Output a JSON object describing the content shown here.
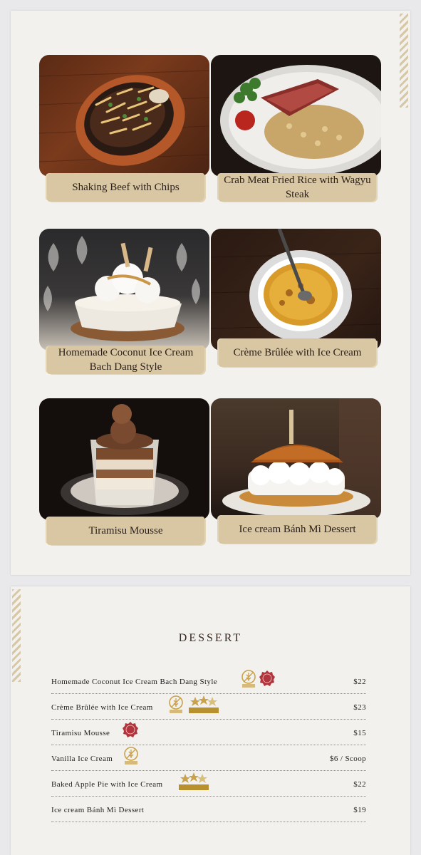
{
  "gallery": {
    "items": [
      {
        "caption": "Shaking Beef with Chips"
      },
      {
        "caption": "Crab Meat Fried Rice with Wagyu Steak"
      },
      {
        "caption": "Homemade Coconut Ice Cream Bach Dang Style"
      },
      {
        "caption": "Crème Brûlée with Ice Cream"
      },
      {
        "caption": "Tiramisu Mousse"
      },
      {
        "caption": "Ice cream Bánh Mì Dessert"
      }
    ]
  },
  "menu": {
    "title": "DESSERT",
    "items": [
      {
        "name": "Homemade Coconut Ice Cream Bach Dang Style",
        "price": "$22",
        "badges": [
          "gluten-free",
          "vegetarian"
        ]
      },
      {
        "name": "Crème Brûlée with Ice Cream",
        "price": "$23",
        "badges": [
          "gluten-free",
          "recommended"
        ]
      },
      {
        "name": "Tiramisu Mousse",
        "price": "$15",
        "badges": [
          "vegetarian"
        ]
      },
      {
        "name": "Vanilla Ice Cream",
        "price": "$6 / Scoop",
        "badges": [
          "gluten-free"
        ]
      },
      {
        "name": "Baked Apple Pie with Ice Cream",
        "price": "$22",
        "badges": [
          "recommended"
        ]
      },
      {
        "name": "Ice cream Bánh Mì Dessert",
        "price": "$19",
        "badges": []
      }
    ],
    "badge_labels": {
      "gluten_free": "GLUTEN FREE",
      "vegetarian": "VEGETARIAN",
      "recommended": "RECOMMENDED"
    }
  },
  "colors": {
    "page": "#f3f1ed",
    "caption_bg": "#d8c7a2",
    "gold": "#c9a24a",
    "veg_red": "#b2343c"
  }
}
